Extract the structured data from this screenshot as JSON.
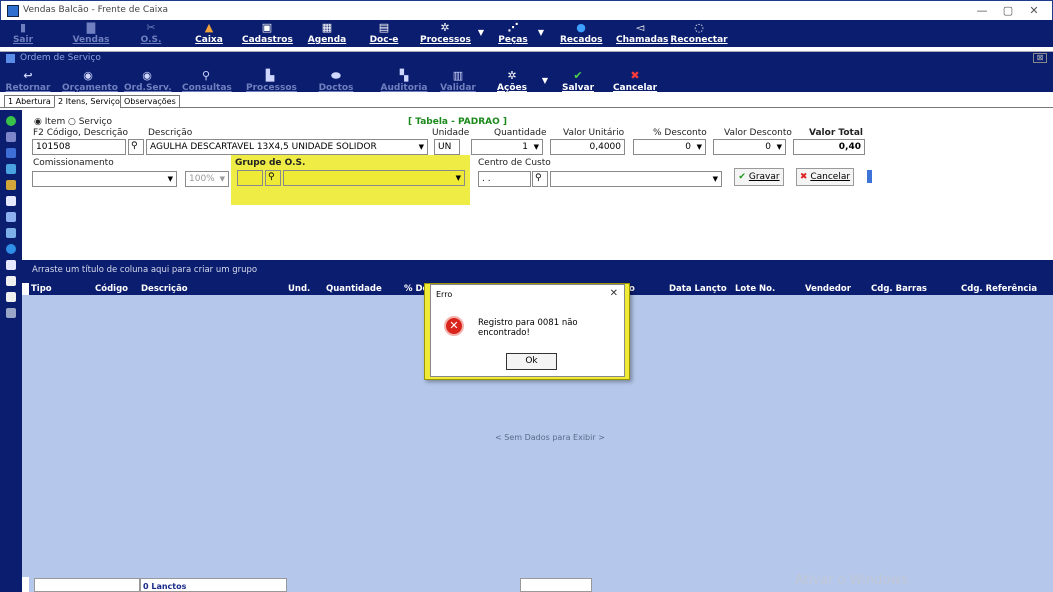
{
  "window": {
    "title": "Vendas Balcão - Frente de Caixa",
    "controls": {
      "minimize": "—",
      "maximize": "▢",
      "close": "✕"
    }
  },
  "main_toolbar": {
    "items": [
      {
        "label": "Sair",
        "icon": "exit-icon"
      },
      {
        "label": "Vendas",
        "icon": "sales-icon"
      },
      {
        "label": "O.S.",
        "icon": "tools-icon"
      },
      {
        "label": "Caixa",
        "icon": "cashier-icon"
      },
      {
        "label": "Cadastros",
        "icon": "register-icon"
      },
      {
        "label": "Agenda",
        "icon": "calendar-icon"
      },
      {
        "label": "Doc-e",
        "icon": "doc-icon"
      },
      {
        "label": "Processos",
        "icon": "process-icon"
      },
      {
        "label": "Peças",
        "icon": "parts-icon"
      },
      {
        "label": "Recados",
        "icon": "message-icon"
      },
      {
        "label": "Chamadas",
        "icon": "call-icon"
      },
      {
        "label": "Reconectar",
        "icon": "reconnect-icon"
      }
    ]
  },
  "subwindow": {
    "title": "Ordem de Serviço",
    "close_label": "⊠"
  },
  "os_toolbar": {
    "items": [
      {
        "label": "Retornar"
      },
      {
        "label": "Orçamento"
      },
      {
        "label": "Ord.Serv."
      },
      {
        "label": "Consultas"
      },
      {
        "label": "Processos"
      },
      {
        "label": "Doctos"
      },
      {
        "label": "Auditoria"
      },
      {
        "label": "Validar"
      },
      {
        "label": "Ações"
      },
      {
        "label": "Salvar"
      },
      {
        "label": "Cancelar"
      }
    ]
  },
  "tabs": [
    "1 Abertura",
    "2 Itens, Serviços",
    "Observações"
  ],
  "form": {
    "radio_item": "Item",
    "radio_service": "Serviço",
    "table_label": "[ Tabela - PADRAO ]",
    "code_label": "F2 Código, Descrição",
    "code_value": "101508",
    "desc_label": "Descrição",
    "desc_value": "AGULHA DESCARTAVEL 13X4,5 UNIDADE SOLIDOR",
    "unit_label": "Unidade",
    "unit_value": "UN",
    "qty_label": "Quantidade",
    "qty_value": "1",
    "unit_price_label": "Valor Unitário",
    "unit_price_value": "0,4000",
    "discount_pct_label": "% Desconto",
    "discount_pct_value": "0",
    "discount_val_label": "Valor Desconto",
    "discount_val_value": "0",
    "total_label": "Valor Total",
    "total_value": "0,40",
    "commission_label": "Comissionamento",
    "commission_pct": "100%",
    "os_group_label": "Grupo de O.S.",
    "cost_center_label": "Centro de Custo",
    "cost_center_value": ". .",
    "save_button": "Gravar",
    "cancel_button": "Cancelar"
  },
  "grid": {
    "group_hint": "Arraste um título de coluna aqui para criar um grupo",
    "columns": [
      "Tipo",
      "Código",
      "Descrição",
      "Und.",
      "Quantidade",
      "% Desc",
      "o",
      "Data Lançto",
      "Lote No.",
      "Vendedor",
      "Cdg. Barras",
      "Cdg. Referência"
    ],
    "empty_text": "< Sem Dados para Exibir >",
    "footer_count": "0 Lanctos"
  },
  "dialog": {
    "title": "Erro",
    "close": "✕",
    "message": "Registro para 0081 não encontrado!",
    "ok": "Ok"
  },
  "watermark": "Ativar o Windows",
  "colors": {
    "nav_bg": "#0b1d6e",
    "highlight": "#eeea36",
    "grid_bg": "#b5c8ec",
    "green_text": "#1b8a1b"
  }
}
